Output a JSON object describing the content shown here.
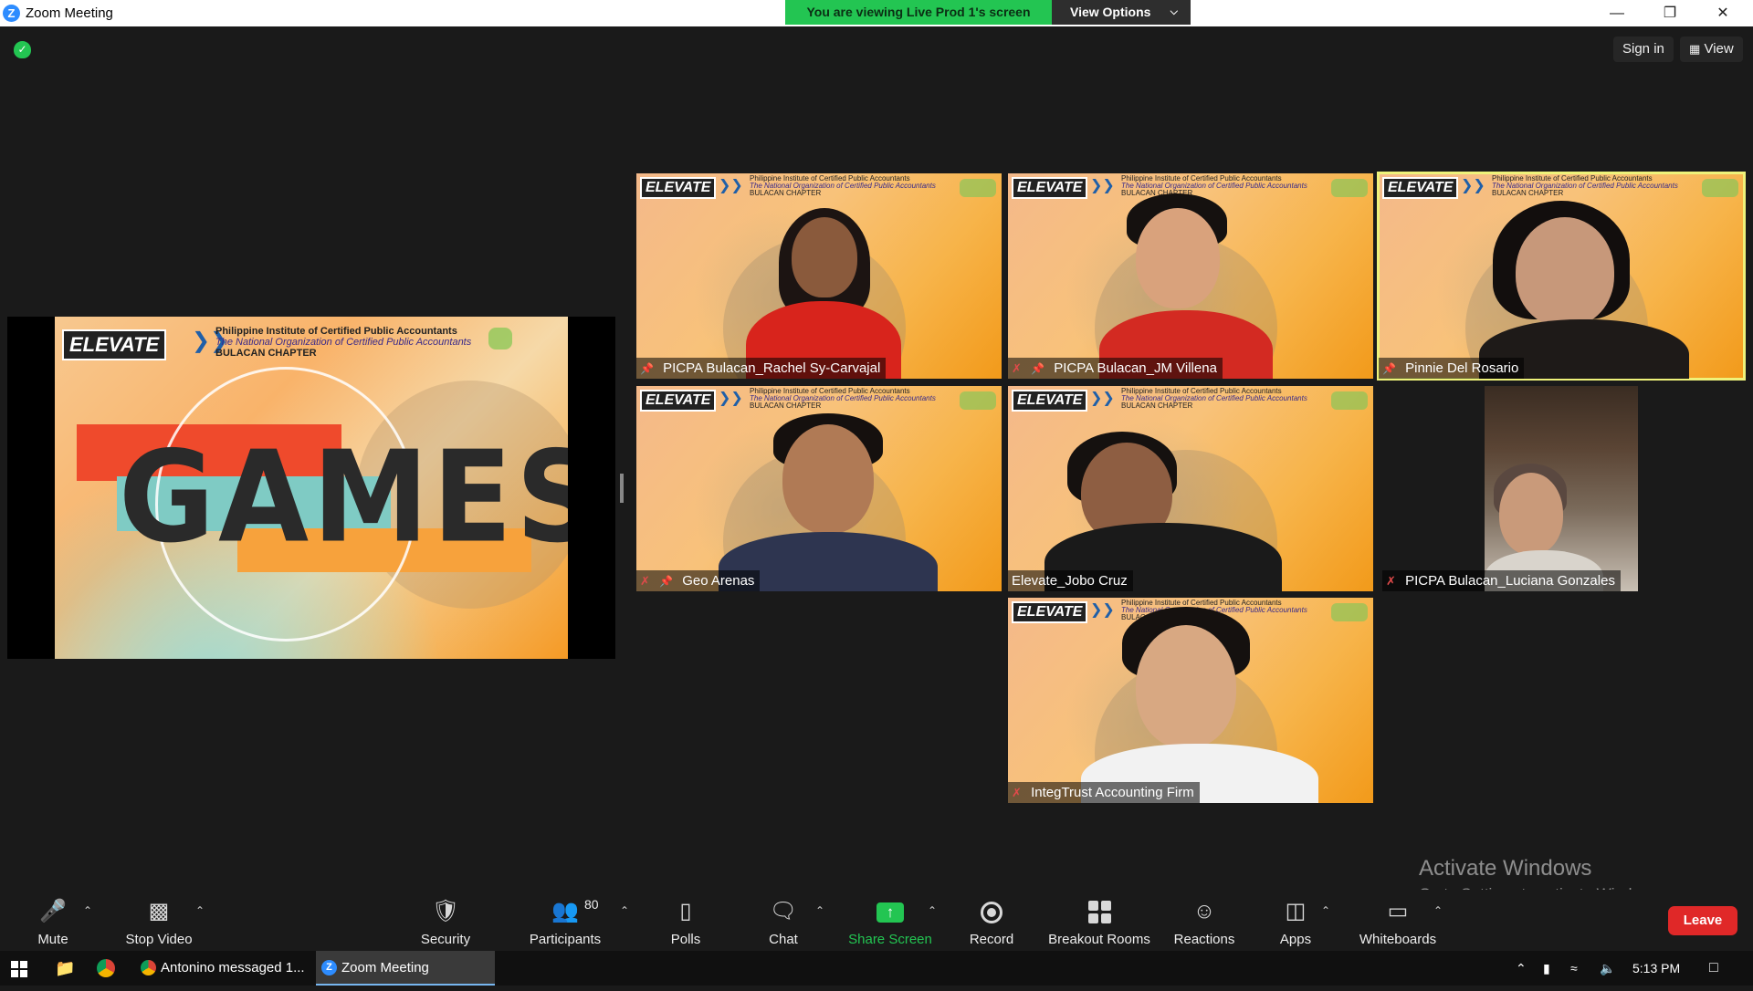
{
  "window": {
    "title": "Zoom Meeting",
    "app_icon": "zoom-icon",
    "controls": [
      "minimize-icon",
      "restore-icon",
      "close-icon"
    ]
  },
  "banner": {
    "viewing_text": "You are viewing Live Prod 1's screen",
    "view_options": "View Options"
  },
  "top_right": {
    "sign_in": "Sign in",
    "view": "View"
  },
  "shared_slide": {
    "logo": "ELEVATE",
    "org_line1": "Philippine Institute of Certified Public Accountants",
    "org_line2": "The National Organization of Certified Public Accountants",
    "org_line3": "BULACAN CHAPTER",
    "title": "GAMES"
  },
  "tiles": [
    {
      "name": "PICPA Bulacan_Rachel Sy-Carvajal",
      "muted": false,
      "pinned": true
    },
    {
      "name": "PICPA Bulacan_JM Villena",
      "muted": true,
      "pinned": true
    },
    {
      "name": "Pinnie Del Rosario",
      "muted": false,
      "pinned": true,
      "active_speaker": true
    },
    {
      "name": "Geo Arenas",
      "muted": true,
      "pinned": true
    },
    {
      "name": "Elevate_Jobo Cruz",
      "muted": false,
      "pinned": false
    },
    {
      "name": "PICPA Bulacan_Luciana Gonzales",
      "muted": true,
      "pinned": false
    },
    {
      "name": "IntegTrust Accounting Firm",
      "muted": true,
      "pinned": false
    }
  ],
  "watermark": {
    "line1": "Activate Windows",
    "line2": "Go to Settings to activate Windows."
  },
  "toolbar": {
    "mute": "Mute",
    "stop_video": "Stop Video",
    "security": "Security",
    "participants": "Participants",
    "participant_count": "80",
    "polls": "Polls",
    "chat": "Chat",
    "share_screen": "Share Screen",
    "record": "Record",
    "breakout_rooms": "Breakout Rooms",
    "reactions": "Reactions",
    "apps": "Apps",
    "whiteboards": "Whiteboards",
    "leave": "Leave"
  },
  "taskbar": {
    "apps": [
      {
        "label": "Antonino messaged 1...",
        "icon": "chrome-icon"
      },
      {
        "label": "Zoom Meeting",
        "icon": "zoom-icon",
        "active": true
      }
    ],
    "time": "5:13 PM"
  },
  "colors": {
    "accent_green": "#23c552",
    "leave_red": "#e02828",
    "zoom_blue": "#2d8cff",
    "speaker_highlight": "#eef27a"
  }
}
